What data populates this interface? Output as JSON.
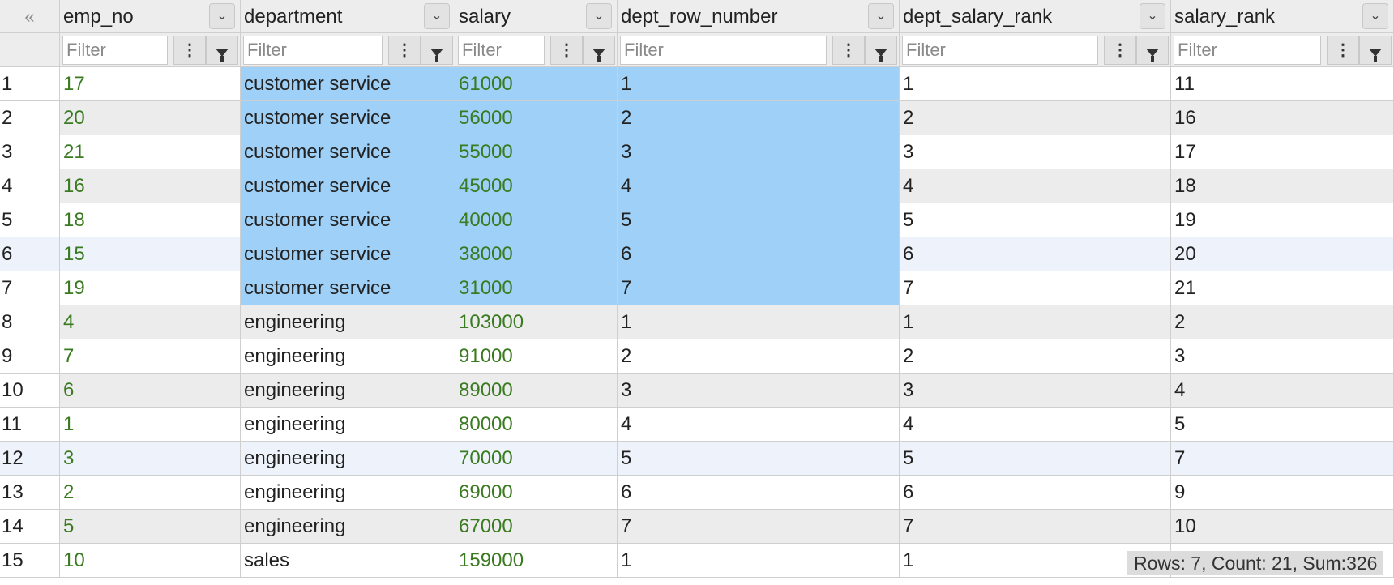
{
  "header": {
    "collapse_symbol": "«",
    "columns": [
      "emp_no",
      "department",
      "salary",
      "dept_row_number",
      "dept_salary_rank",
      "salary_rank"
    ]
  },
  "filter_placeholder": "Filter",
  "rows": [
    [
      "1",
      "17",
      "customer service",
      "61000",
      "1",
      "1",
      "11"
    ],
    [
      "2",
      "20",
      "customer service",
      "56000",
      "2",
      "2",
      "16"
    ],
    [
      "3",
      "21",
      "customer service",
      "55000",
      "3",
      "3",
      "17"
    ],
    [
      "4",
      "16",
      "customer service",
      "45000",
      "4",
      "4",
      "18"
    ],
    [
      "5",
      "18",
      "customer service",
      "40000",
      "5",
      "5",
      "19"
    ],
    [
      "6",
      "15",
      "customer service",
      "38000",
      "6",
      "6",
      "20"
    ],
    [
      "7",
      "19",
      "customer service",
      "31000",
      "7",
      "7",
      "21"
    ],
    [
      "8",
      "4",
      "engineering",
      "103000",
      "1",
      "1",
      "2"
    ],
    [
      "9",
      "7",
      "engineering",
      "91000",
      "2",
      "2",
      "3"
    ],
    [
      "10",
      "6",
      "engineering",
      "89000",
      "3",
      "3",
      "4"
    ],
    [
      "11",
      "1",
      "engineering",
      "80000",
      "4",
      "4",
      "5"
    ],
    [
      "12",
      "3",
      "engineering",
      "70000",
      "5",
      "5",
      "7"
    ],
    [
      "13",
      "2",
      "engineering",
      "69000",
      "6",
      "6",
      "9"
    ],
    [
      "14",
      "5",
      "engineering",
      "67000",
      "7",
      "7",
      "10"
    ],
    [
      "15",
      "10",
      "sales",
      "159000",
      "1",
      "1",
      ""
    ]
  ],
  "status_bar": "Rows: 7, Count: 21, Sum:326",
  "colors": {
    "selection": "#9fd0f7",
    "numeric_text": "#3a7a20",
    "hover_row": "#eef3fb"
  }
}
